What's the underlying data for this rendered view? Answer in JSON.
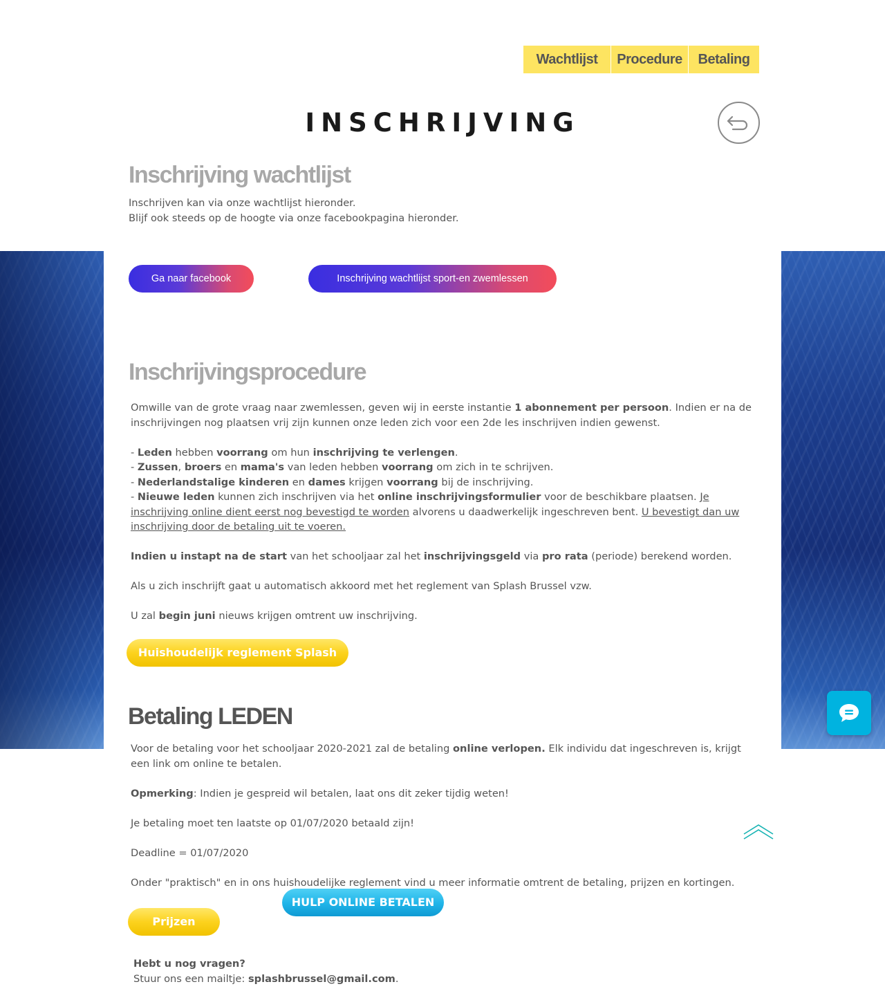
{
  "nav": {
    "items": [
      {
        "label": "Wachtlijst"
      },
      {
        "label": "Procedure"
      },
      {
        "label": "Betaling"
      }
    ]
  },
  "page_title": "INSCHRIJVING",
  "wachtlijst": {
    "heading": "Inschrijving wachtlijst",
    "line1": "Inschrijven kan via onze wachtlijst hieronder.",
    "line2": "Blijf ook steeds op de hoogte via onze facebookpagina hieronder.",
    "facebook_button": "Ga naar facebook",
    "waitlist_button": "Inschrijving wachtlijst sport-en zwemlessen"
  },
  "procedure": {
    "heading": "Inschrijvingsprocedure",
    "p1_a": "Omwille van de grote vraag naar zwemlessen, geven wij in eerste instantie ",
    "p1_b": "1 abonnement per persoon",
    "p1_c": ". Indien er na de inschrijvingen nog plaatsen vrij zijn kunnen onze leden zich voor een 2de les inschrijven indien gewenst.",
    "b1": [
      "- ",
      "Leden",
      " hebben ",
      "voorrang",
      " om hun ",
      "inschrijving te verlengen",
      "."
    ],
    "b2": [
      "- ",
      "Zussen",
      ", ",
      "broers",
      " en ",
      "mama's",
      " van leden hebben ",
      "voorrang",
      " om zich in te schrijven."
    ],
    "b3": [
      "- ",
      "Nederlandstalige kinderen",
      " en ",
      "dames",
      " krijgen ",
      "voorrang",
      " bij de inschrijving."
    ],
    "b4": [
      "- ",
      "Nieuwe leden",
      " kunnen zich inschrijven via het ",
      "online inschrijvingsformulier",
      " voor de beschikbare plaatsen. ",
      "Je inschrijving online dient eerst nog bevestigd te worden",
      " alvorens u daadwerkelijk ingeschreven bent. ",
      "U bevestigt dan uw inschrijving door de betaling uit te voeren."
    ],
    "p2": [
      "Indien u instapt na de start",
      " van het schooljaar zal het ",
      "inschrijvingsgeld",
      " via ",
      "pro rata",
      " (periode) berekend worden."
    ],
    "p3": "Als u zich inschrijft gaat u automatisch akkoord met het reglement van Splash Brussel vzw.",
    "p4": [
      "U zal ",
      "begin juni",
      " nieuws krijgen omtrent uw inschrijving."
    ],
    "reglement_button": "Huishoudelijk reglement Splash"
  },
  "betaling": {
    "heading": "Betaling LEDEN",
    "p1": [
      "Voor de betaling voor het schooljaar 2020-2021 zal de betaling ",
      "online verlopen.",
      " Elk individu dat ingeschreven is, krijgt een link om online te betalen."
    ],
    "p2": [
      "Opmerking",
      ": Indien je gespreid wil betalen, laat ons dit zeker tijdig weten!"
    ],
    "p3": "Je betaling moet ten laatste op 01/07/2020 betaald zijn!",
    "p4": "Deadline = 01/07/2020",
    "p5": "Onder \"praktisch\" en in ons huishoudelijke reglement vind u meer informatie omtrent de betaling, prijzen en kortingen.",
    "help_button": "HULP ONLINE BETALEN",
    "prices_button": "Prijzen"
  },
  "contact": {
    "question": "Hebt u nog vragen?",
    "mail_prefix": "Stuur ons een mailtje: ",
    "email": "splashbrussel@gmail.com",
    "mail_suffix": "."
  },
  "icons": {
    "back": "back-arrow-icon",
    "chat": "chat-bubble-icon",
    "scroll_top": "chevron-up-icon"
  },
  "colors": {
    "nav_bg": "#fde461",
    "chat_bg": "#00b3e0",
    "yellow_button": "#fcd21e",
    "blue_button": "#1fb4e8"
  }
}
